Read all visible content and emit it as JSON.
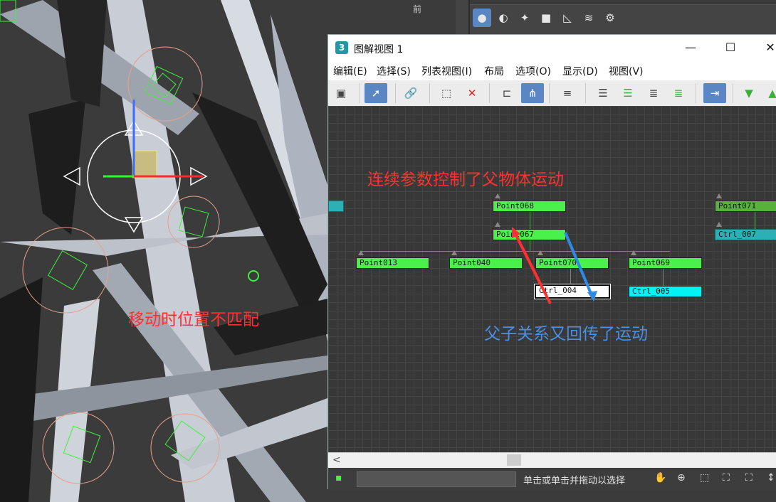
{
  "window": {
    "title": "图解视图 1",
    "app_icon": "3",
    "minimize": "—",
    "maximize": "☐",
    "close": "✕"
  },
  "menu": [
    "编辑(E)",
    "选择(S)",
    "列表视图(I)",
    "布局",
    "选项(O)",
    "显示(D)",
    "视图(V)"
  ],
  "viewport": {
    "label": "前"
  },
  "nodes": {
    "point068": "Point068",
    "point067": "Point067",
    "point013": "Point013",
    "point040": "Point040",
    "point070": "Point070",
    "point069": "Point069",
    "ctrl004": "Ctrl_004",
    "ctrl005": "Ctrl_005",
    "point071": "Point071",
    "ctrl007": "Ctrl_007"
  },
  "annotations": {
    "parent_motion": "连续参数控制了父物体运动",
    "feedback": "父子关系又回传了运动",
    "position_mismatch": "移动时位置不匹配"
  },
  "status": {
    "text": "单击或单击并拖动以选择"
  },
  "colors": {
    "accent": "#5b86c4",
    "node_green": "#4cf04c",
    "node_cyan": "#00f4f4",
    "annotation_red": "#ff3030",
    "annotation_blue": "#4a90e2"
  }
}
